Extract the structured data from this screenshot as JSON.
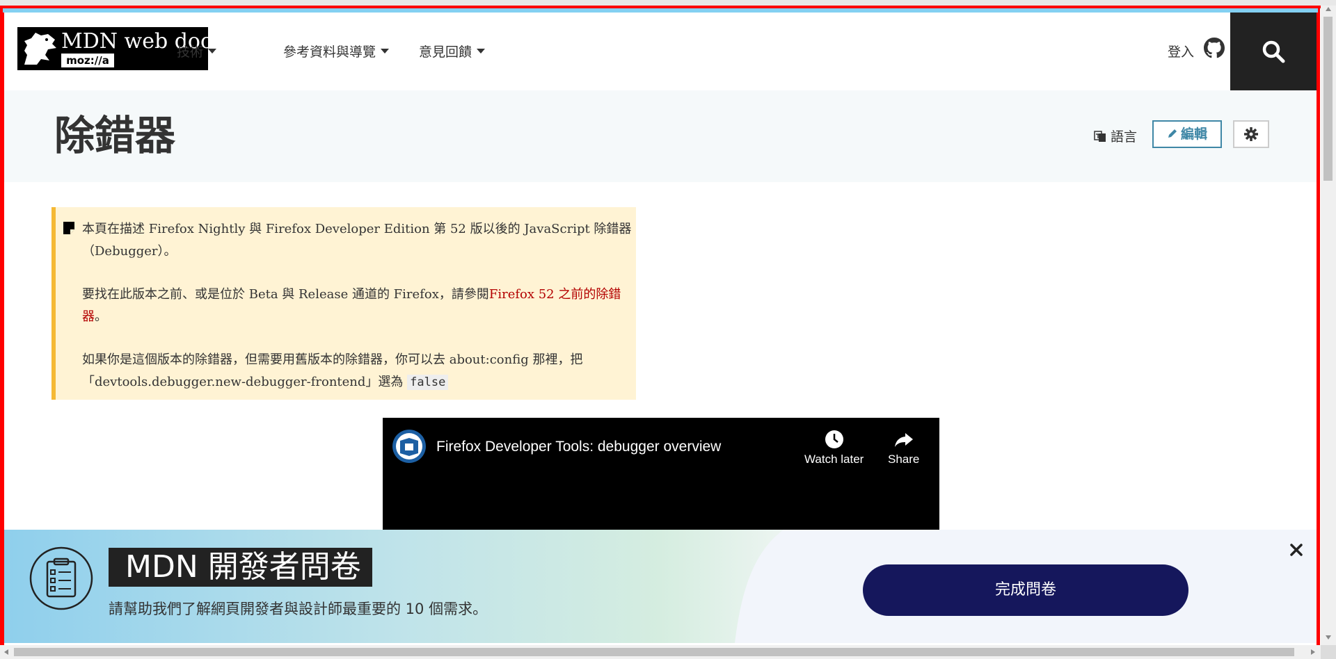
{
  "header": {
    "logo_title": "MDN web docs",
    "logo_sub": "moz://a",
    "nav": [
      "技術",
      "參考資料與導覽",
      "意見回饋"
    ],
    "signin": "登入"
  },
  "titlebar": {
    "title": "除錯器",
    "language": "語言",
    "edit": "編輯"
  },
  "note": {
    "p1": "本頁在描述 Firefox Nightly 與 Firefox Developer Edition 第 52 版以後的 JavaScript 除錯器（Debugger）。",
    "p2_before": "要找在此版本之前、或是位於 Beta 與 Release 通道的 Firefox，請參閱",
    "p2_link": "Firefox 52 之前的除錯器",
    "p2_after": "。",
    "p3_before": "如果你是這個版本的除錯器，但需要用舊版本的除錯器，你可以去 about:config 那裡，把「devtools.debugger.new-debugger-frontend」選為 ",
    "p3_code": "false"
  },
  "video": {
    "title": "Firefox Developer Tools: debugger overview",
    "watch_later": "Watch later",
    "share": "Share"
  },
  "banner": {
    "title": "MDN 開發者問卷",
    "subtitle": "請幫助我們了解網頁開發者與設計師最重要的 10 個需求。",
    "button": "完成問卷"
  },
  "colors": {
    "accent_blue": "#83d0f2",
    "link_red": "#b30000",
    "note_bg": "#fff3d4",
    "note_border": "#f5b935",
    "button_navy": "#15175c"
  }
}
